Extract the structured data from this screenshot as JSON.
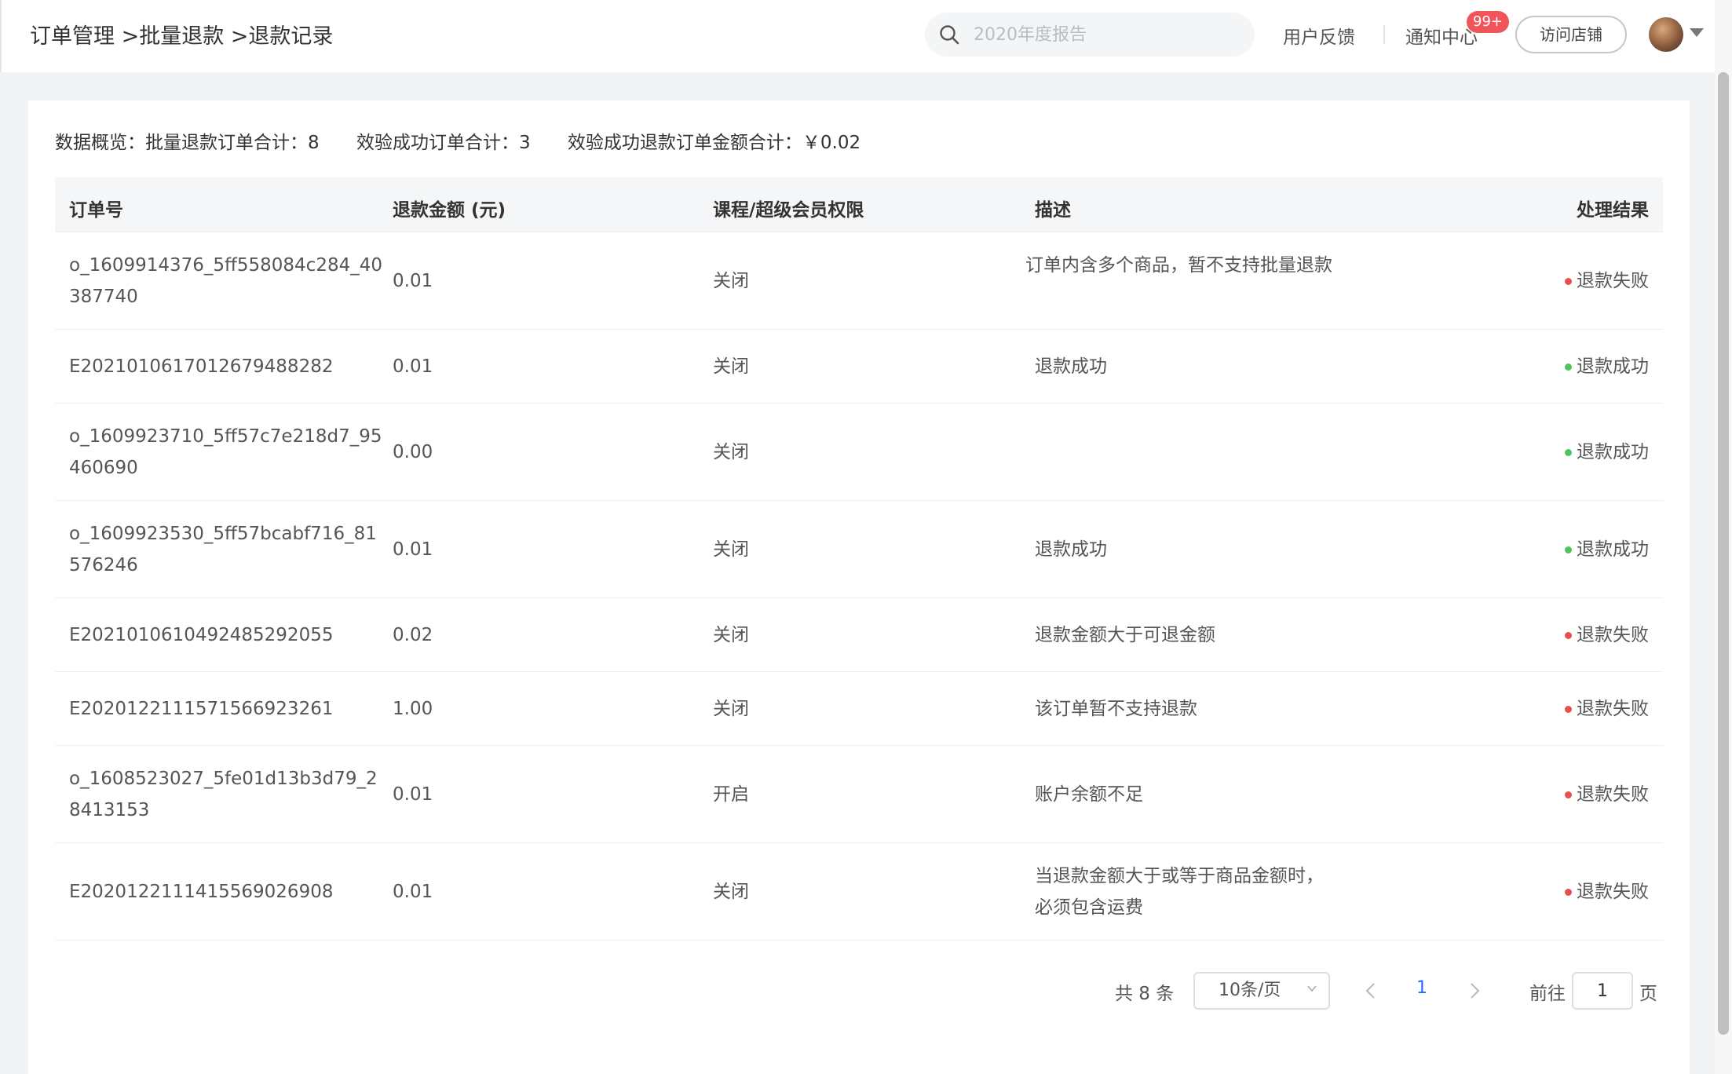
{
  "header": {
    "breadcrumb": "订单管理 >批量退款 >退款记录",
    "search_placeholder": "2020年度报告",
    "feedback": "用户反馈",
    "notifications": "通知中心",
    "notification_badge": "99+",
    "visit_store": "访问店铺"
  },
  "summary": {
    "total_label": "数据概览：批量退款订单合计：8",
    "success_label": "效验成功订单合计：3",
    "amount_label": "效验成功退款订单金额合计：￥0.02"
  },
  "table": {
    "columns": [
      "订单号",
      "退款金额 (元)",
      "课程/超级会员权限",
      "描述",
      "处理结果"
    ],
    "rows": [
      {
        "order": "o_1609914376_5ff558084c284_40387740",
        "amount": "0.01",
        "course": "关闭",
        "desc": "订单内含多个商品，暂不支持批量退款",
        "result": "退款失败",
        "status": "fail"
      },
      {
        "order": "E202101061701267948828 2",
        "amount": "0.01",
        "course": "关闭",
        "desc": "退款成功",
        "result": "退款成功",
        "status": "success"
      },
      {
        "order": "o_1609923710_5ff57c7e218d7_95460690",
        "amount": "0.00",
        "course": "关闭",
        "desc": "",
        "result": "退款成功",
        "status": "success"
      },
      {
        "order": "o_1609923530_5ff57bcabf716_81576246",
        "amount": "0.01",
        "course": "关闭",
        "desc": "退款成功",
        "result": "退款成功",
        "status": "success"
      },
      {
        "order": "E202101061049248529205 5",
        "amount": "0.02",
        "course": "关闭",
        "desc": "退款金额大于可退金额",
        "result": "退款失败",
        "status": "fail"
      },
      {
        "order": "E202012211157156692326 1",
        "amount": "1.00",
        "course": "关闭",
        "desc": "该订单暂不支持退款",
        "result": "退款失败",
        "status": "fail"
      },
      {
        "order": "o_1608523027_5fe01d13b3d79_28413153",
        "amount": "0.01",
        "course": "开启",
        "desc": "账户余额不足",
        "result": "退款失败",
        "status": "fail"
      },
      {
        "order": "E202012211141556902690 8",
        "amount": "0.01",
        "course": "关闭",
        "desc": "当退款金额大于或等于商品金额时，必须包含运费",
        "result": "退款失败",
        "status": "fail"
      }
    ]
  },
  "pagination": {
    "total": "共 8 条",
    "page_size": "10条/页",
    "current_page": "1",
    "goto_label": "前往",
    "goto_value": "1",
    "page_suffix": "页"
  },
  "colors": {
    "fail": "#e8504f",
    "success": "#4cc35b",
    "accent": "#2b6cf6",
    "badge": "#f1555a"
  }
}
